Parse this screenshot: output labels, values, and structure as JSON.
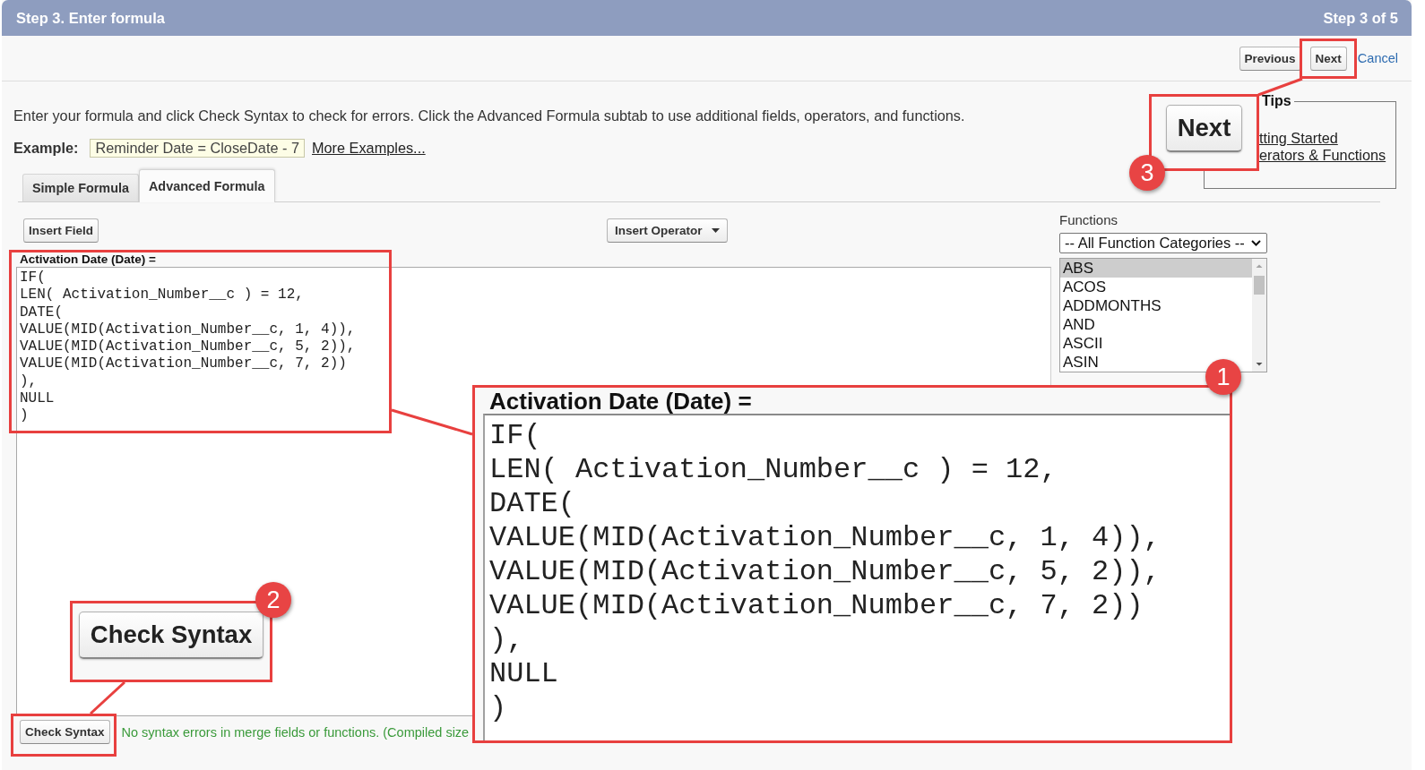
{
  "header": {
    "title": "Step 3. Enter formula",
    "step": "Step 3 of 5"
  },
  "nav": [
    {
      "kind": "button",
      "label": "Previous"
    },
    {
      "kind": "button",
      "label": "Next"
    },
    {
      "kind": "link",
      "label": "Cancel"
    }
  ],
  "instructions": "Enter your formula and click Check Syntax to check for errors. Click the Advanced Formula subtab to use additional fields, operators, and functions.",
  "example": {
    "label": "Example:",
    "formula": "Reminder Date = CloseDate - 7",
    "link": "More Examples..."
  },
  "tips": {
    "title": "Tips",
    "links": [
      "tting Started",
      "erators & Functions"
    ]
  },
  "tabs": [
    {
      "label": "Simple Formula",
      "selected": false
    },
    {
      "label": "Advanced Formula",
      "selected": true
    }
  ],
  "editor": {
    "insert_field": "Insert Field",
    "insert_operator": "Insert Operator",
    "field_label": "Activation Date (Date) =",
    "formula": [
      "IF(",
      "LEN( Activation_Number__c ) = 12,",
      "DATE(",
      "VALUE(MID(Activation_Number__c, 1, 4)),",
      "VALUE(MID(Activation_Number__c, 5, 2)),",
      "VALUE(MID(Activation_Number__c, 7, 2))",
      "),",
      "NULL",
      ")"
    ],
    "check_syntax": "Check Syntax",
    "message": "No syntax errors in merge fields or functions. (Compiled size"
  },
  "functions": {
    "label": "Functions",
    "category": "-- All Function Categories --",
    "items": [
      {
        "name": "ABS",
        "selected": true
      },
      {
        "name": "ACOS",
        "selected": false
      },
      {
        "name": "ADDMONTHS",
        "selected": false
      },
      {
        "name": "AND",
        "selected": false
      },
      {
        "name": "ASCII",
        "selected": false
      },
      {
        "name": "ASIN",
        "selected": false
      }
    ]
  },
  "callouts": [
    {
      "number": "1",
      "kind": "code",
      "label": "Activation Date (Date) =",
      "lines": [
        "IF(",
        "LEN( Activation_Number__c ) = 12,",
        "DATE(",
        "VALUE(MID(Activation_Number__c, 1, 4)),",
        "VALUE(MID(Activation_Number__c, 5, 2)),",
        "VALUE(MID(Activation_Number__c, 7, 2))",
        "),",
        "NULL",
        ")"
      ]
    },
    {
      "number": "2",
      "kind": "button",
      "label": "Check Syntax"
    },
    {
      "number": "3",
      "kind": "button",
      "label": "Next"
    }
  ]
}
